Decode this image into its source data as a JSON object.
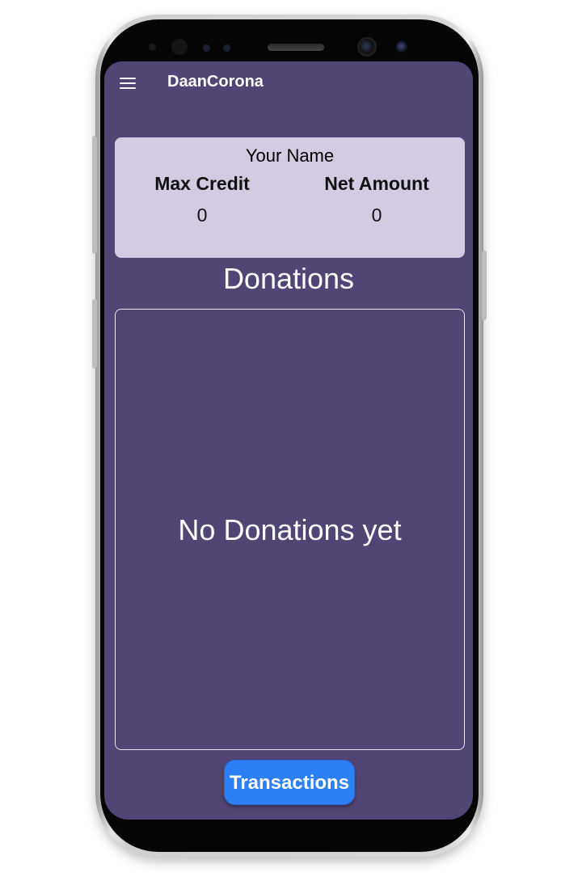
{
  "app_bar": {
    "title": "DaanCorona",
    "menu_icon": "hamburger-menu-icon"
  },
  "profile": {
    "name": "Your Name",
    "max_credit_label": "Max Credit",
    "max_credit_value": "0",
    "net_amount_label": "Net Amount",
    "net_amount_value": "0"
  },
  "donations": {
    "title": "Donations",
    "empty_message": "No Donations yet"
  },
  "footer": {
    "transactions_label": "Transactions"
  },
  "colors": {
    "screen_background": "#504574",
    "card_background": "#d3cbe2",
    "button_background": "#2d7ff5",
    "text_light": "#ffffff"
  }
}
